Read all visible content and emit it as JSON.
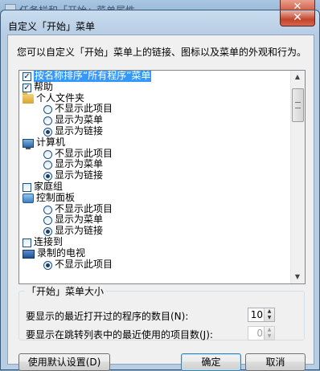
{
  "background_window": {
    "title": "任务栏和「开始」菜单属性",
    "close_label": "✕"
  },
  "dialog": {
    "title": "自定义「开始」菜单",
    "close_label": "✕",
    "description": "您可以自定义「开始」菜单上的链接、图标以及菜单的外观和行为。",
    "items": [
      {
        "type": "checkbox",
        "label": "按名称排序“所有程序”菜单",
        "checked": true,
        "selected": true
      },
      {
        "type": "checkbox",
        "label": "帮助",
        "checked": true
      },
      {
        "type": "header",
        "icon": "folder-icon",
        "label": "个人文件夹"
      },
      {
        "type": "radio",
        "label": "不显示此项目",
        "checked": false
      },
      {
        "type": "radio",
        "label": "显示为菜单",
        "checked": false
      },
      {
        "type": "radio",
        "label": "显示为链接",
        "checked": true
      },
      {
        "type": "header",
        "icon": "computer-icon",
        "label": "计算机"
      },
      {
        "type": "radio",
        "label": "不显示此项目",
        "checked": false
      },
      {
        "type": "radio",
        "label": "显示为菜单",
        "checked": false
      },
      {
        "type": "radio",
        "label": "显示为链接",
        "checked": true
      },
      {
        "type": "checkbox",
        "label": "家庭组",
        "checked": false
      },
      {
        "type": "header",
        "icon": "control-panel-icon",
        "label": "控制面板"
      },
      {
        "type": "radio",
        "label": "不显示此项目",
        "checked": false
      },
      {
        "type": "radio",
        "label": "显示为菜单",
        "checked": false
      },
      {
        "type": "radio",
        "label": "显示为链接",
        "checked": true
      },
      {
        "type": "checkbox",
        "label": "连接到",
        "checked": false
      },
      {
        "type": "header",
        "icon": "tv-icon",
        "label": "录制的电视"
      },
      {
        "type": "radio",
        "label": "不显示此项目",
        "checked": true
      }
    ],
    "size_group": {
      "title": "「开始」菜单大小",
      "recent_programs_label": "要显示的最近打开过的程序的数目(N):",
      "recent_programs_value": "10",
      "jump_list_label": "要显示在跳转列表中的最近使用的项目数(J):",
      "jump_list_value": "0"
    },
    "buttons": {
      "defaults": "使用默认设置(D)",
      "ok": "确定",
      "cancel": "取消"
    }
  }
}
